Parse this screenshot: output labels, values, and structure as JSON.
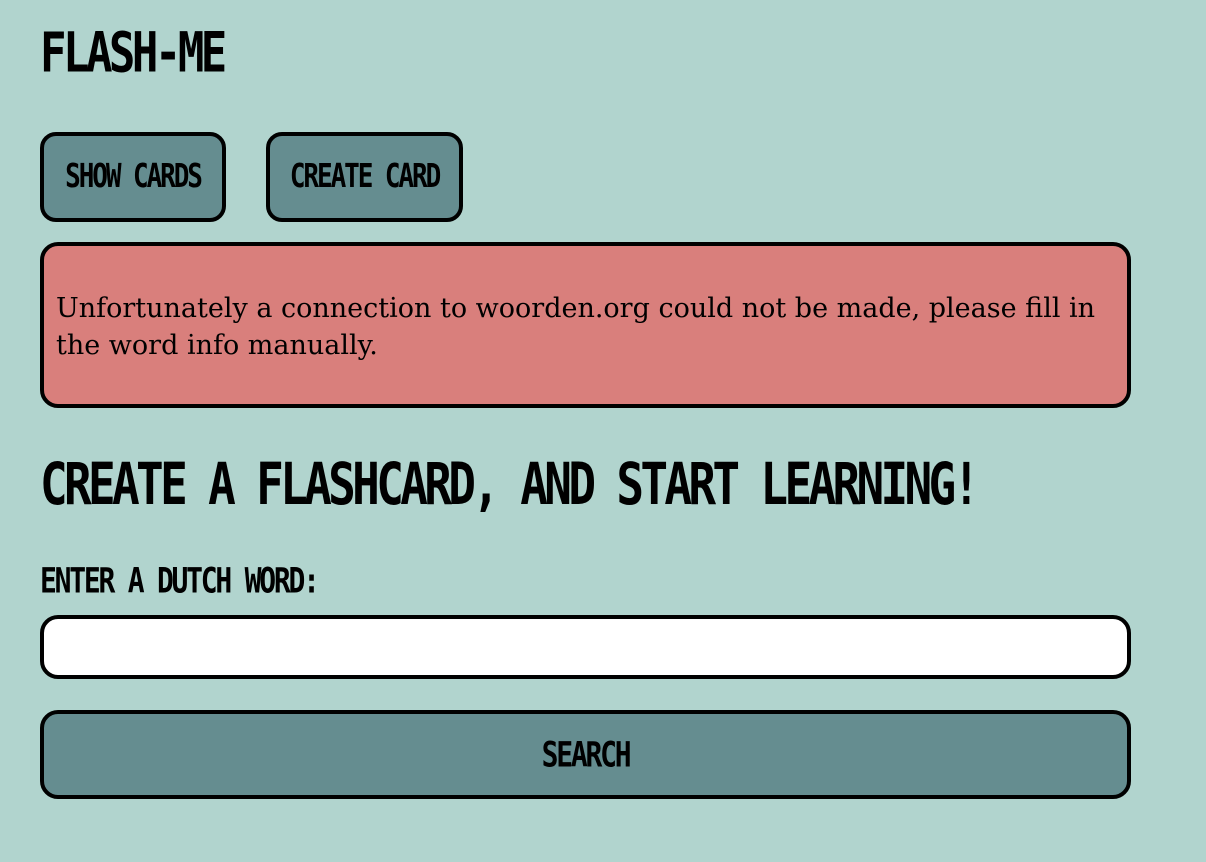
{
  "app": {
    "title": "FLASH-ME"
  },
  "nav": {
    "show_cards": "SHOW CARDS",
    "create_card": "CREATE CARD"
  },
  "alert": {
    "message": "Unfortunately a connection to woorden.org could not be made, please fill in the word info manually."
  },
  "form": {
    "heading": "CREATE A FLASHCARD, AND START LEARNING!",
    "label": "ENTER A DUTCH WORD:",
    "input_value": "",
    "search_label": "SEARCH"
  },
  "colors": {
    "background": "#b1d4ce",
    "button": "#658d90",
    "alert": "#d97f7c",
    "border": "#000000",
    "input": "#ffffff"
  }
}
